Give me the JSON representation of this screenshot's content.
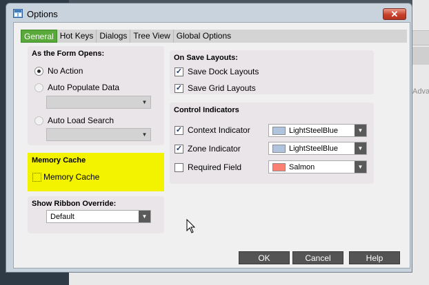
{
  "dialog": {
    "title": "Options",
    "close_glyph": "✕",
    "icon": "options-app-icon"
  },
  "tabs": [
    {
      "label": "General",
      "active": true
    },
    {
      "label": "Hot Keys",
      "active": false
    },
    {
      "label": "Dialogs",
      "active": false
    },
    {
      "label": "Tree View",
      "active": false
    },
    {
      "label": "Global Options",
      "active": false
    }
  ],
  "form_opens": {
    "title": "As the Form Opens:",
    "options": [
      {
        "label": "No Action",
        "checked": true
      },
      {
        "label": "Auto Populate Data",
        "checked": false
      },
      {
        "label": "Auto Load Search",
        "checked": false
      }
    ],
    "populate_select": "",
    "search_select": ""
  },
  "memory_cache": {
    "title": "Memory Cache",
    "checkbox_label": "Memory Cache",
    "checked": false,
    "highlight_color": "#f3f300"
  },
  "ribbon": {
    "title": "Show Ribbon Override:",
    "value": "Default"
  },
  "save_layouts": {
    "title": "On Save Layouts:",
    "items": [
      {
        "label": "Save Dock Layouts",
        "checked": true
      },
      {
        "label": "Save Grid Layouts",
        "checked": true
      }
    ]
  },
  "control_indicators": {
    "title": "Control Indicators",
    "items": [
      {
        "label": "Context Indicator",
        "checked": true,
        "color_name": "LightSteelBlue",
        "color": "#b0c4de"
      },
      {
        "label": "Zone Indicator",
        "checked": true,
        "color_name": "LightSteelBlue",
        "color": "#b0c4de"
      },
      {
        "label": "Required Field",
        "checked": false,
        "color_name": "Salmon",
        "color": "#fa8072"
      }
    ]
  },
  "buttons": {
    "ok": "OK",
    "cancel": "Cancel",
    "help": "Help"
  },
  "background": {
    "adv_text": "Adva"
  },
  "colors": {
    "active_tab": "#59a83a",
    "button_bg": "#545454",
    "close_button": "#c8412b"
  }
}
